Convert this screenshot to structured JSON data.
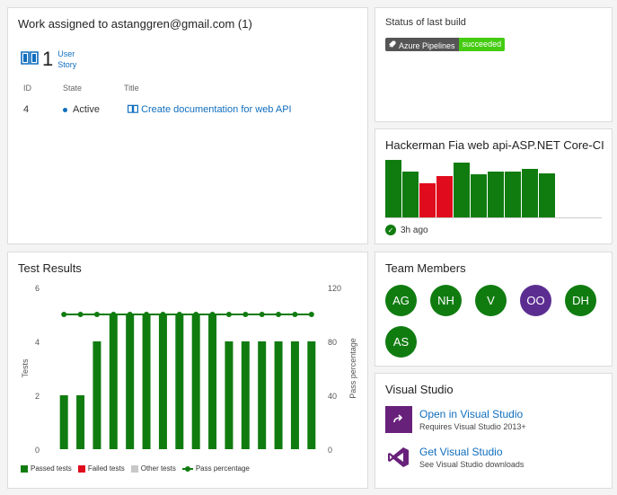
{
  "work": {
    "title": "Work assigned to astanggren@gmail.com (1)",
    "count": "1",
    "type_line1": "User",
    "type_line2": "Story",
    "headers": {
      "id": "ID",
      "state": "State",
      "title": "Title"
    },
    "item": {
      "id": "4",
      "state": "Active",
      "title": "Create documentation for web API"
    }
  },
  "build_status": {
    "title": "Status of last build",
    "badge_label": "Azure Pipelines",
    "badge_value": "succeeded"
  },
  "build_history": {
    "title": "Hackerman Fia web api-ASP.NET Core-CI",
    "ago": "3h ago",
    "builds": [
      {
        "status": "succeeded",
        "duration": 1.0
      },
      {
        "status": "succeeded",
        "duration": 0.8
      },
      {
        "status": "failed",
        "duration": 0.6
      },
      {
        "status": "failed",
        "duration": 0.72
      },
      {
        "status": "succeeded",
        "duration": 0.95
      },
      {
        "status": "succeeded",
        "duration": 0.75
      },
      {
        "status": "succeeded",
        "duration": 0.8
      },
      {
        "status": "succeeded",
        "duration": 0.8
      },
      {
        "status": "succeeded",
        "duration": 0.85
      },
      {
        "status": "succeeded",
        "duration": 0.76
      }
    ],
    "colors": {
      "succeeded": "#107c10",
      "failed": "#e00b1c"
    }
  },
  "tests": {
    "title": "Test Results",
    "legend": {
      "passed": "Passed tests",
      "failed": "Failed tests",
      "other": "Other tests",
      "pass_pct": "Pass percentage"
    },
    "colors": {
      "passed": "#107c10",
      "failed": "#e00b1c",
      "other": "#c8c8c8"
    }
  },
  "chart_data": {
    "type": "bar",
    "title": "Test Results",
    "ylabel": "Tests",
    "y2label": "Pass percentage",
    "ylim": [
      0,
      6
    ],
    "y2lim": [
      0,
      120
    ],
    "yticks": [
      0,
      2,
      4,
      6
    ],
    "y2ticks": [
      0,
      40,
      80,
      120
    ],
    "series": [
      {
        "name": "Passed tests",
        "values": [
          2,
          2,
          4,
          5,
          5,
          5,
          5,
          5,
          5,
          5,
          4,
          4,
          4,
          4,
          4,
          4
        ]
      },
      {
        "name": "Pass percentage",
        "values": [
          100,
          100,
          100,
          100,
          100,
          100,
          100,
          100,
          100,
          100,
          100,
          100,
          100,
          100,
          100,
          100
        ]
      }
    ],
    "grid": false,
    "legend_position": "bottom-left"
  },
  "team": {
    "title": "Team Members",
    "members": [
      {
        "initials": "AG",
        "color": "#107c10"
      },
      {
        "initials": "NH",
        "color": "#107c10"
      },
      {
        "initials": "V",
        "color": "#107c10"
      },
      {
        "initials": "OO",
        "color": "#5c2d91"
      },
      {
        "initials": "DH",
        "color": "#107c10"
      },
      {
        "initials": "AS",
        "color": "#107c10"
      }
    ]
  },
  "visual_studio": {
    "title": "Visual Studio",
    "open_label": "Open in Visual Studio",
    "open_sub": "Requires Visual Studio 2013+",
    "get_label": "Get Visual Studio",
    "get_sub": "See Visual Studio downloads"
  }
}
